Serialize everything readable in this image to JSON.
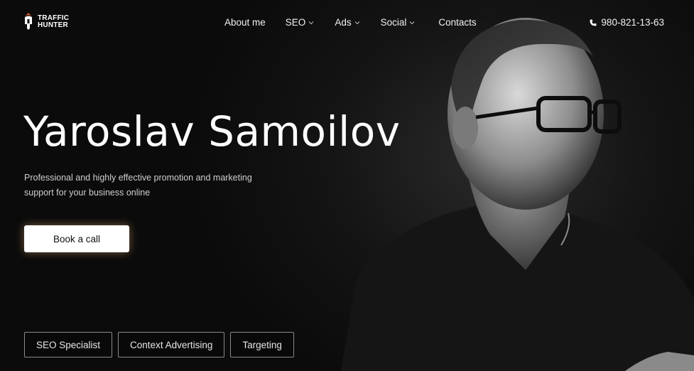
{
  "brand": {
    "line1": "TRAFFIC",
    "line2": "HUNTER",
    "accent": "#e05a1c"
  },
  "nav": {
    "items": [
      {
        "label": "About me"
      },
      {
        "label": "SEO"
      },
      {
        "label": "Ads"
      },
      {
        "label": "Social"
      },
      {
        "label": "Contacts"
      }
    ]
  },
  "phone": {
    "number": "980-821-13-63",
    "icon": "phone-icon"
  },
  "hero": {
    "title": "Yaroslav Samoilov",
    "subtitle": "Professional and highly effective promotion and marketing support for your business online",
    "cta_label": "Book a call"
  },
  "tags": [
    {
      "label": "SEO Specialist"
    },
    {
      "label": "Context Advertising"
    },
    {
      "label": "Targeting"
    }
  ],
  "colors": {
    "background": "#0b0b0b",
    "text": "#ffffff",
    "muted": "#cfcfcf",
    "button_bg": "#ffffff",
    "button_glow": "#ffbe78"
  }
}
